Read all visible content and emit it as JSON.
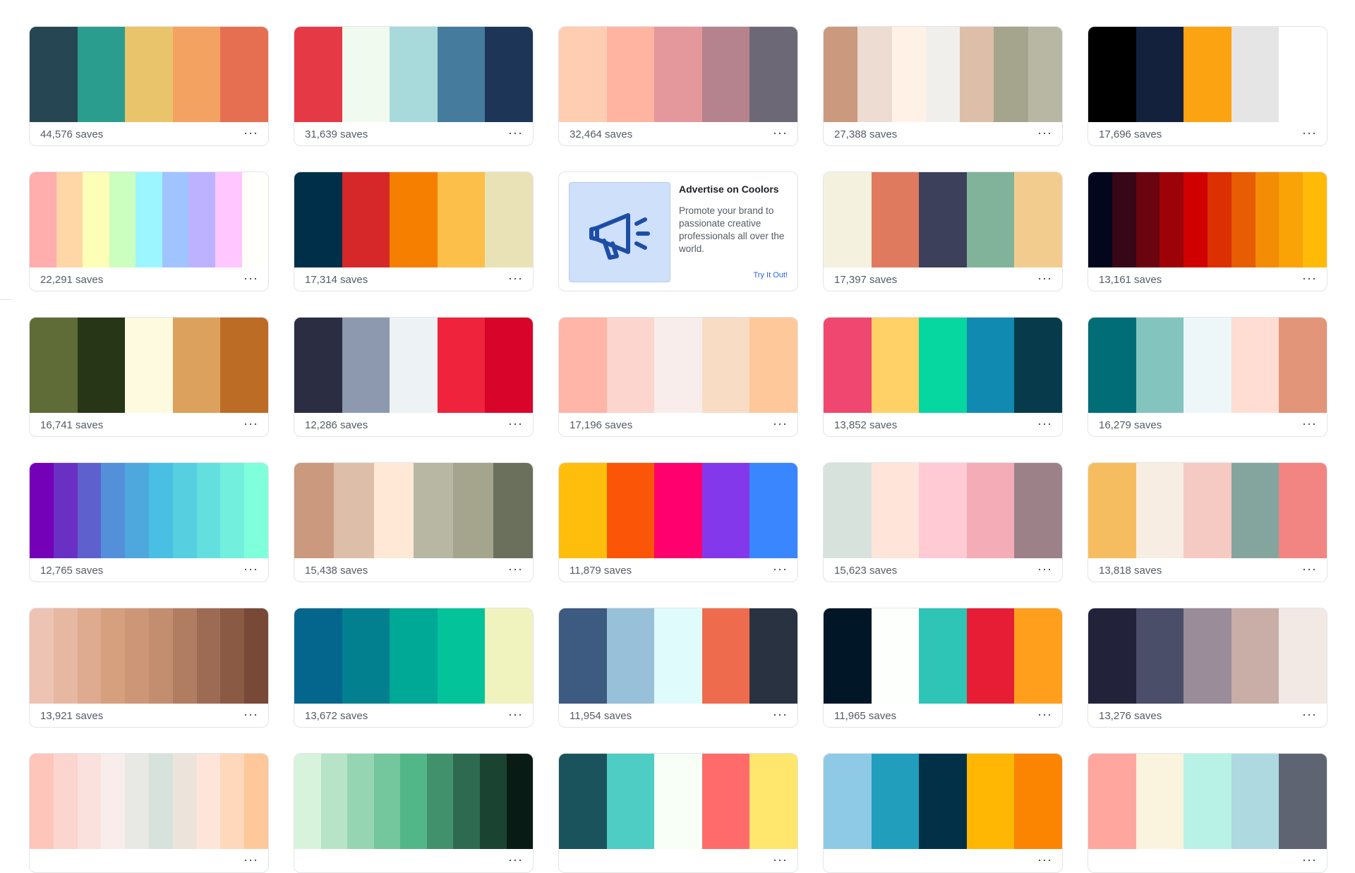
{
  "ad": {
    "title": "Advertise on Coolors",
    "body": "Promote your brand to passionate creative professionals all over the world.",
    "link": "Try It Out!"
  },
  "more_label": "···",
  "palettes": [
    {
      "saves": "44,576 saves",
      "colors": [
        "#264653",
        "#2a9d8f",
        "#e9c46a",
        "#f4a261",
        "#e76f51"
      ]
    },
    {
      "saves": "31,639 saves",
      "colors": [
        "#e63946",
        "#f1faee",
        "#a8dadc",
        "#457b9d",
        "#1d3557"
      ]
    },
    {
      "saves": "32,464 saves",
      "colors": [
        "#ffcdb2",
        "#ffb4a2",
        "#e5989b",
        "#b5838d",
        "#6d6875"
      ]
    },
    {
      "saves": "27,388 saves",
      "colors": [
        "#cb997e",
        "#eddcd2",
        "#fff1e6",
        "#f0efeb",
        "#ddbea9",
        "#a5a58d",
        "#b7b7a4"
      ]
    },
    {
      "saves": "17,696 saves",
      "colors": [
        "#000000",
        "#14213d",
        "#fca311",
        "#e5e5e5",
        "#ffffff"
      ]
    },
    {
      "saves": "22,291 saves",
      "colors": [
        "#ffadad",
        "#ffd6a5",
        "#fdffb6",
        "#caffbf",
        "#9bf6ff",
        "#a0c4ff",
        "#bdb2ff",
        "#ffc6ff",
        "#fffffc"
      ]
    },
    {
      "saves": "17,314 saves",
      "colors": [
        "#003049",
        "#d62828",
        "#f77f00",
        "#fcbf49",
        "#eae2b7"
      ]
    },
    {
      "ad": true
    },
    {
      "saves": "17,397 saves",
      "colors": [
        "#f4f1de",
        "#e07a5f",
        "#3d405b",
        "#81b29a",
        "#f2cc8f"
      ]
    },
    {
      "saves": "13,161 saves",
      "colors": [
        "#03071e",
        "#370617",
        "#6a040f",
        "#9d0208",
        "#d00000",
        "#dc2f02",
        "#e85d04",
        "#f48c06",
        "#faa307",
        "#ffba08"
      ]
    },
    {
      "saves": "16,741 saves",
      "colors": [
        "#606c38",
        "#283618",
        "#fefae0",
        "#dda15e",
        "#bc6c25"
      ]
    },
    {
      "saves": "12,286 saves",
      "colors": [
        "#2b2d42",
        "#8d99ae",
        "#edf2f4",
        "#ef233c",
        "#d90429"
      ]
    },
    {
      "saves": "17,196 saves",
      "colors": [
        "#ffb5a7",
        "#fcd5ce",
        "#f8edeb",
        "#f9dcc4",
        "#fec89a"
      ]
    },
    {
      "saves": "13,852 saves",
      "colors": [
        "#ef476f",
        "#ffd166",
        "#06d6a0",
        "#118ab2",
        "#073b4c"
      ]
    },
    {
      "saves": "16,279 saves",
      "colors": [
        "#006d77",
        "#83c5be",
        "#edf6f9",
        "#ffddd2",
        "#e29578"
      ]
    },
    {
      "saves": "12,765 saves",
      "colors": [
        "#7400b8",
        "#6930c3",
        "#5e60ce",
        "#5390d9",
        "#4ea8de",
        "#48bfe3",
        "#56cfe1",
        "#64dfdf",
        "#72efdd",
        "#80ffdb"
      ]
    },
    {
      "saves": "15,438 saves",
      "colors": [
        "#cb997e",
        "#ddbea9",
        "#ffe8d6",
        "#b7b7a4",
        "#a5a58d",
        "#6b705c"
      ]
    },
    {
      "saves": "11,879 saves",
      "colors": [
        "#ffbe0b",
        "#fb5607",
        "#ff006e",
        "#8338ec",
        "#3a86ff"
      ]
    },
    {
      "saves": "15,623 saves",
      "colors": [
        "#d8e2dc",
        "#ffe5d9",
        "#ffcad4",
        "#f4acb7",
        "#9d8189"
      ]
    },
    {
      "saves": "13,818 saves",
      "colors": [
        "#f6bd60",
        "#f7ede2",
        "#f5cac3",
        "#84a59d",
        "#f28482"
      ]
    },
    {
      "saves": "13,921 saves",
      "colors": [
        "#edc4b3",
        "#e6b8a2",
        "#deab90",
        "#d69f7e",
        "#cd9777",
        "#c38e70",
        "#b07d62",
        "#9d6b53",
        "#8a5a44",
        "#774936"
      ]
    },
    {
      "saves": "13,672 saves",
      "colors": [
        "#05668d",
        "#028090",
        "#00a896",
        "#02c39a",
        "#f0f3bd"
      ]
    },
    {
      "saves": "11,954 saves",
      "colors": [
        "#3d5a80",
        "#98c1d9",
        "#e0fbfc",
        "#ee6c4d",
        "#293241"
      ]
    },
    {
      "saves": "11,965 saves",
      "colors": [
        "#011627",
        "#fdfffc",
        "#2ec4b6",
        "#e71d36",
        "#ff9f1c"
      ]
    },
    {
      "saves": "13,276 saves",
      "colors": [
        "#22223b",
        "#4a4e69",
        "#9a8c98",
        "#c9ada7",
        "#f2e9e4"
      ]
    },
    {
      "saves": "",
      "colors": [
        "#fec5bb",
        "#fcd5ce",
        "#fae1dd",
        "#f8edeb",
        "#e8e8e4",
        "#d8e2dc",
        "#ece4db",
        "#ffe5d9",
        "#ffd7ba",
        "#fec89a"
      ]
    },
    {
      "saves": "",
      "colors": [
        "#d8f3dc",
        "#b7e4c7",
        "#95d5b2",
        "#74c69d",
        "#52b788",
        "#40916c",
        "#2d6a4f",
        "#1b4332",
        "#081c15"
      ]
    },
    {
      "saves": "",
      "colors": [
        "#1a535c",
        "#4ecdc4",
        "#f7fff7",
        "#ff6b6b",
        "#ffe66d"
      ]
    },
    {
      "saves": "",
      "colors": [
        "#8ecae6",
        "#219ebc",
        "#023047",
        "#ffb703",
        "#fb8500"
      ]
    },
    {
      "saves": "",
      "colors": [
        "#ffa69e",
        "#faf3dd",
        "#b8f2e6",
        "#aed9e0",
        "#5e6472"
      ]
    }
  ]
}
